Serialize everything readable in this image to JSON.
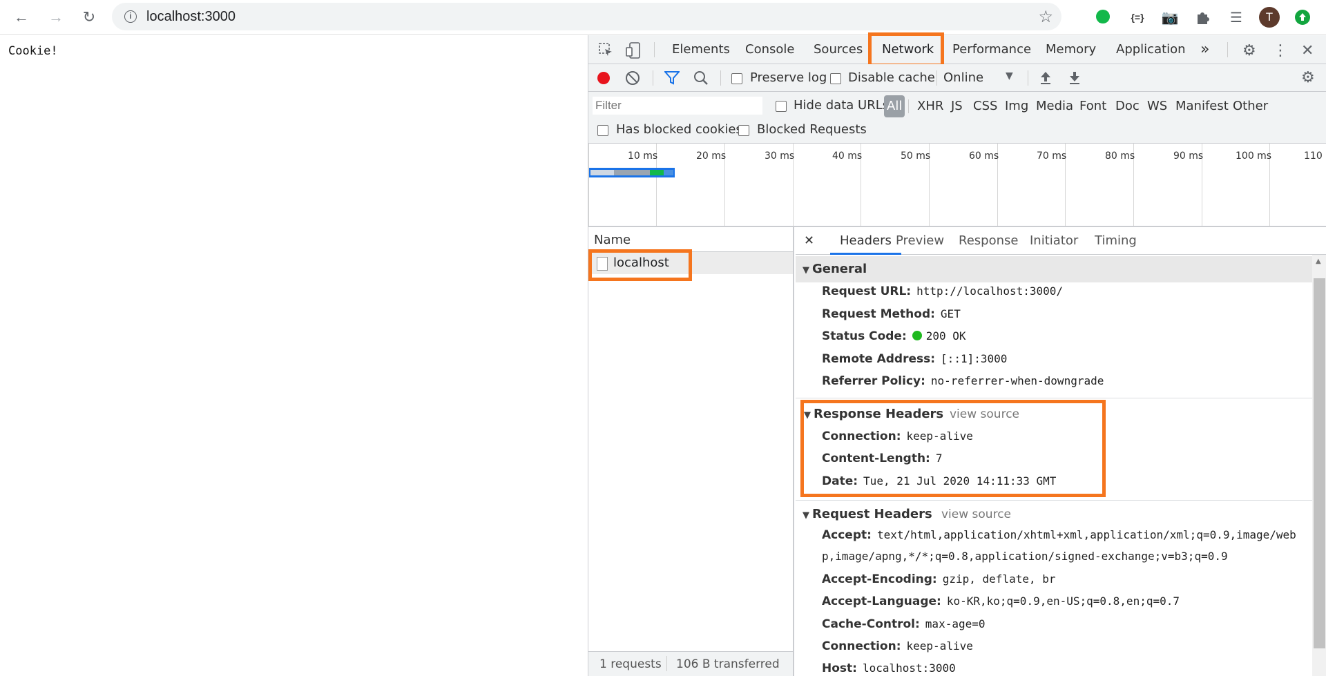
{
  "browser": {
    "url": "localhost:3000",
    "avatar_letter": "T"
  },
  "page": {
    "body_text": "Cookie!"
  },
  "devtools": {
    "tabs": [
      "Elements",
      "Console",
      "Sources",
      "Network",
      "Performance",
      "Memory",
      "Application"
    ],
    "active_tab": "Network",
    "more_tabs": "»",
    "toolbar": {
      "preserve_log": "Preserve log",
      "disable_cache": "Disable cache",
      "throttling": "Online"
    },
    "filter": {
      "placeholder": "Filter",
      "hide_data_urls": "Hide data URLs",
      "types": [
        "All",
        "XHR",
        "JS",
        "CSS",
        "Img",
        "Media",
        "Font",
        "Doc",
        "WS",
        "Manifest",
        "Other"
      ],
      "has_blocked_cookies": "Has blocked cookies",
      "blocked_requests": "Blocked Requests"
    },
    "timeline_ticks": [
      "10 ms",
      "20 ms",
      "30 ms",
      "40 ms",
      "50 ms",
      "60 ms",
      "70 ms",
      "80 ms",
      "90 ms",
      "100 ms",
      "110 ms"
    ],
    "name_column": "Name",
    "requests": [
      "localhost"
    ],
    "status": {
      "requests": "1 requests",
      "transferred": "106 B transferred"
    },
    "detail_tabs": [
      "Headers",
      "Preview",
      "Response",
      "Initiator",
      "Timing"
    ],
    "general": {
      "title": "General",
      "request_url_k": "Request URL:",
      "request_url_v": "http://localhost:3000/",
      "method_k": "Request Method:",
      "method_v": "GET",
      "status_k": "Status Code:",
      "status_v": "200 OK",
      "remote_k": "Remote Address:",
      "remote_v": "[::1]:3000",
      "referrer_k": "Referrer Policy:",
      "referrer_v": "no-referrer-when-downgrade"
    },
    "response_headers": {
      "title": "Response Headers",
      "view_source": "view source",
      "connection_k": "Connection:",
      "connection_v": "keep-alive",
      "length_k": "Content-Length:",
      "length_v": "7",
      "date_k": "Date:",
      "date_v": "Tue, 21 Jul 2020 14:11:33 GMT"
    },
    "request_headers": {
      "title": "Request Headers",
      "view_source": "view source",
      "accept_k": "Accept:",
      "accept_v1": "text/html,application/xhtml+xml,application/xml;q=0.9,image/web",
      "accept_v2": "p,image/apng,*/*;q=0.8,application/signed-exchange;v=b3;q=0.9",
      "encoding_k": "Accept-Encoding:",
      "encoding_v": "gzip, deflate, br",
      "language_k": "Accept-Language:",
      "language_v": "ko-KR,ko;q=0.9,en-US;q=0.8,en;q=0.7",
      "cache_k": "Cache-Control:",
      "cache_v": "max-age=0",
      "connection_k": "Connection:",
      "connection_v": "keep-alive",
      "host_k": "Host:",
      "host_v": "localhost:3000"
    }
  },
  "colors": {
    "highlight": "#f5751e",
    "record": "#e8141d",
    "status_ok": "#1fb91f",
    "active_tab": "#1a73e8"
  }
}
